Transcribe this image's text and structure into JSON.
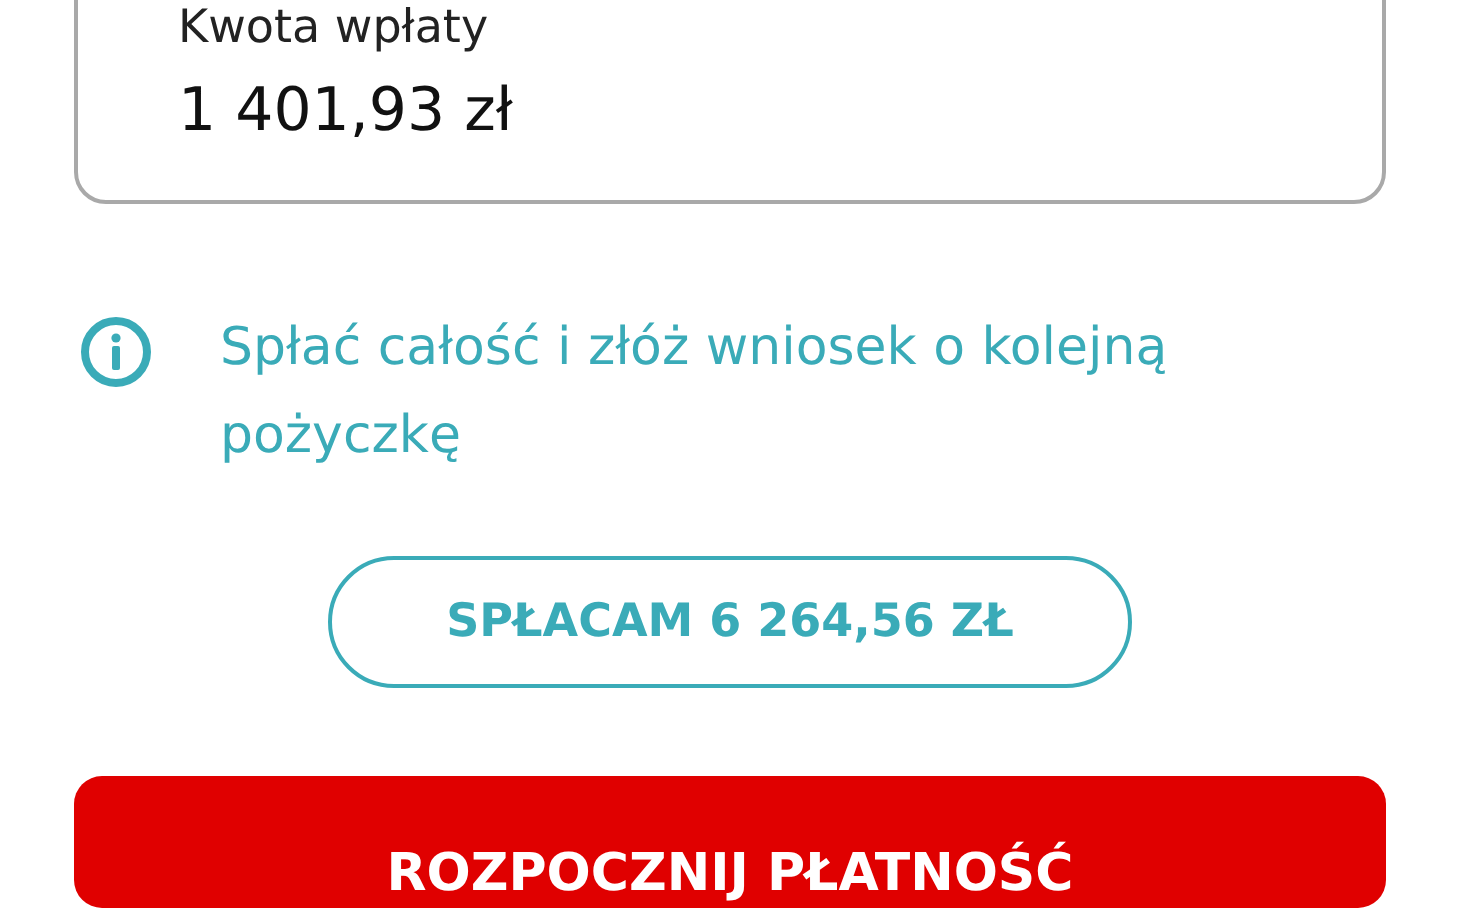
{
  "amount_field": {
    "label": "Kwota wpłaty",
    "value": "1 401,93 zł"
  },
  "info": {
    "text": "Spłać całość i złóż wniosek o kolejną pożyczkę"
  },
  "repay_all_button": {
    "label": "SPŁACAM 6 264,56 ZŁ"
  },
  "start_payment_button": {
    "label": "ROZPOCZNIJ PŁATNOŚĆ"
  }
}
